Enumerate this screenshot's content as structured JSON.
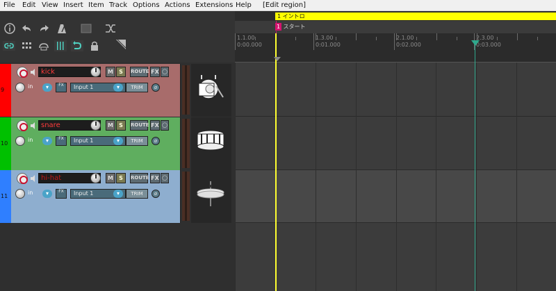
{
  "menu": [
    "File",
    "Edit",
    "View",
    "Insert",
    "Item",
    "Track",
    "Options",
    "Actions",
    "Extensions",
    "Help",
    "[Edit region]"
  ],
  "toolbar": {
    "icons": [
      "info-icon",
      "undo-icon",
      "redo-icon",
      "metronome-icon",
      "grid-square-icon",
      "tempo-icon",
      "link-icon",
      "grid-icon",
      "snap-icon",
      "dotgrid-icon",
      "loop-icon",
      "lock-icon",
      "envelope-icon"
    ]
  },
  "regions": {
    "region": {
      "number": "1",
      "label": "イントロ",
      "color": "#ffff00"
    },
    "marker": {
      "number": "1",
      "label": "スタート",
      "color": "#d4146f"
    }
  },
  "ruler": {
    "marks": [
      {
        "measure": "1.1.00",
        "time": "0:00.000"
      },
      {
        "measure": "1.3.00",
        "time": "0:01.000"
      },
      {
        "measure": "2.1.00",
        "time": "0:02.000"
      },
      {
        "measure": "2.3.00",
        "time": "0:03.000"
      }
    ]
  },
  "tracks": [
    {
      "number": "9",
      "name": "kick",
      "input": "Input 1",
      "in_label": "in",
      "mute": "M",
      "solo": "S",
      "route": "ROUTE",
      "fx": "FX",
      "trim": "TRIM",
      "color": "#ff0000",
      "panel_color": "#a86c6b",
      "name_color": "#ff3b3b",
      "icon": "kick-drum-icon"
    },
    {
      "number": "10",
      "name": "snare",
      "input": "Input 1",
      "in_label": "in",
      "mute": "M",
      "solo": "S",
      "route": "ROUTE",
      "fx": "FX",
      "trim": "TRIM",
      "color": "#00c000",
      "panel_color": "#5fae5f",
      "name_color": "#ff3b3b",
      "icon": "snare-drum-icon"
    },
    {
      "number": "11",
      "name": "hi-hat",
      "input": "Input 1",
      "in_label": "in",
      "mute": "M",
      "solo": "S",
      "route": "ROUTE",
      "fx": "FX",
      "trim": "TRIM",
      "color": "#2f7fff",
      "panel_color": "#8eaecf",
      "name_color": "#c21818",
      "icon": "hihat-icon"
    }
  ]
}
